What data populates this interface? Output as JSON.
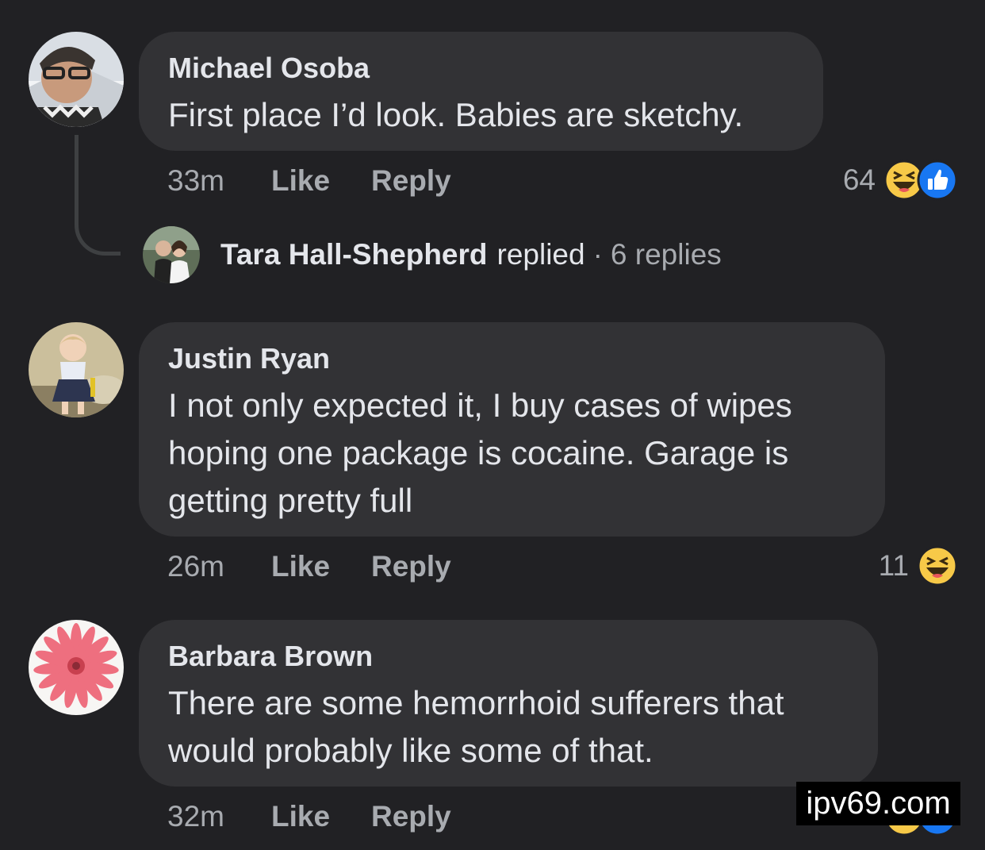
{
  "comments": [
    {
      "author": "Michael Osoba",
      "lines": [
        "First place I’d look. Babies are sketchy."
      ],
      "time": "33m",
      "like_label": "Like",
      "reply_label": "Reply",
      "reaction_count": "64",
      "reactions": [
        "haha-emoji",
        "like-thumb-emoji"
      ]
    },
    {
      "author": "Justin Ryan",
      "lines": [
        "I not only expected it, I buy cases of wipes",
        "hoping one package is cocaine. Garage is",
        "getting pretty full"
      ],
      "time": "26m",
      "like_label": "Like",
      "reply_label": "Reply",
      "reaction_count": "11",
      "reactions": [
        "haha-emoji"
      ]
    },
    {
      "author": "Barbara Brown",
      "lines": [
        "There are some hemorrhoid sufferers that",
        "would probably like some of that."
      ],
      "time": "32m",
      "like_label": "Like",
      "reply_label": "Reply",
      "reactions": [
        "haha-emoji",
        "like-thumb-emoji"
      ]
    }
  ],
  "reply_summary": {
    "name": "Tara Hall-Shepherd",
    "verb": "replied",
    "separator": "·",
    "count_text": "6 replies"
  },
  "watermark": "ipv69.com",
  "colors": {
    "background": "#212124",
    "bubble": "#323235",
    "primary_text": "#e4e6eb",
    "secondary_text": "#a8abb0",
    "haha_yellow": "#f7c948",
    "like_blue": "#1877f2"
  }
}
